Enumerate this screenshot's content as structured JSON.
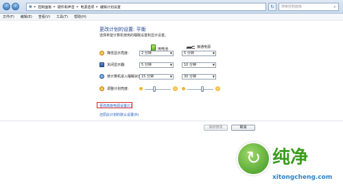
{
  "address": {
    "crumbs": [
      "控制面板",
      "硬件和声音",
      "电源选项",
      "编辑计划设置"
    ],
    "search_placeholder": "搜索控制面板"
  },
  "menu": [
    "文件(F)",
    "编辑(E)",
    "查看(V)",
    "工具(T)",
    "帮助(H)"
  ],
  "page": {
    "title": "更改计划的设置: 平衡",
    "description": "选择希望计算机使用的睡眠设置和显示设置。"
  },
  "columns": {
    "battery": "用电池",
    "plugged": "接通电源"
  },
  "settings": [
    {
      "label": "降低显示亮度:",
      "battery": "2 分钟",
      "plugged": "5 分钟"
    },
    {
      "label": "关闭显示器:",
      "battery": "5 分钟",
      "plugged": "10 分钟"
    },
    {
      "label": "使计算机进入睡眠状态:",
      "battery": "15 分钟",
      "plugged": "30 分钟"
    },
    {
      "label": "调整计划亮度:"
    }
  ],
  "brightness": {
    "battery_level": 0.35,
    "plugged_level": 0.6
  },
  "links": {
    "advanced": "更改高级电源设置(C)",
    "restore": "还原此计划的默认设置(R)"
  },
  "buttons": {
    "save": "保存修改",
    "cancel": "取消"
  },
  "watermark": {
    "text": "纯净",
    "url": "xitongcheng.com"
  },
  "colors": {
    "link": "#1f5bbf",
    "title": "#1a3f8c",
    "highlight": "#d42222"
  }
}
